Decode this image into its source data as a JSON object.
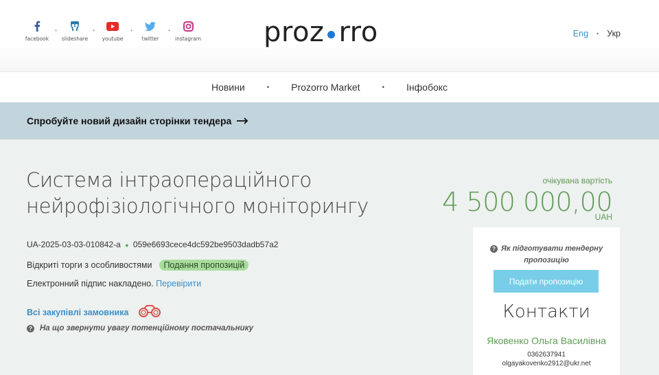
{
  "social": [
    {
      "label": "facebook",
      "icon": "facebook-icon",
      "color": "#3b5998"
    },
    {
      "label": "slideshare",
      "icon": "slideshare-icon",
      "color": "#2d7aa9"
    },
    {
      "label": "youtube",
      "icon": "youtube-icon",
      "color": "#e52d27"
    },
    {
      "label": "twitter",
      "icon": "twitter-icon",
      "color": "#55acee"
    },
    {
      "label": "instagram",
      "icon": "instagram-icon",
      "color": "#c13584"
    }
  ],
  "logo": {
    "left": "proz",
    "right": "rro",
    "dot_color": "#1e78d6"
  },
  "lang": {
    "eng": "Eng",
    "ukr": "Укр"
  },
  "nav": {
    "items": [
      "Новини",
      "Prozorro Market",
      "Інфобокс"
    ]
  },
  "banner": {
    "text": "Спробуйте новий дизайн сторінки тендера"
  },
  "tender": {
    "title": "Система інтраопераційного нейрофізіологічного моніторингу",
    "id": "UA-2025-03-03-010842-a",
    "hash": "059e6693cece4dc592be9503dadb57a2",
    "procedure": "Відкриті торги з особливостями",
    "status": "Подання пропозицій",
    "signature_text": "Електронний підпис накладено.",
    "verify_link": "Перевірити",
    "all_purchases": "Всі закупівлі замовника",
    "attention": "На що звернути увагу потенційному постачальнику"
  },
  "value": {
    "label": "очікувана вартість",
    "amount": "4 500 000,00",
    "currency": "UAH"
  },
  "card": {
    "howto": "Як підготувати тендерну пропозицію",
    "submit": "Подати пропозицію",
    "contacts_title": "Контакти",
    "name": "Яковенко Ольга Василівна",
    "phone": "0362637941",
    "email": "olgayakovenko2912@ukr.net"
  },
  "colors": {
    "accent_blue": "#3d8fc6",
    "green": "#5f9a56",
    "banner": "#c2d4dc",
    "button": "#78cde8"
  }
}
